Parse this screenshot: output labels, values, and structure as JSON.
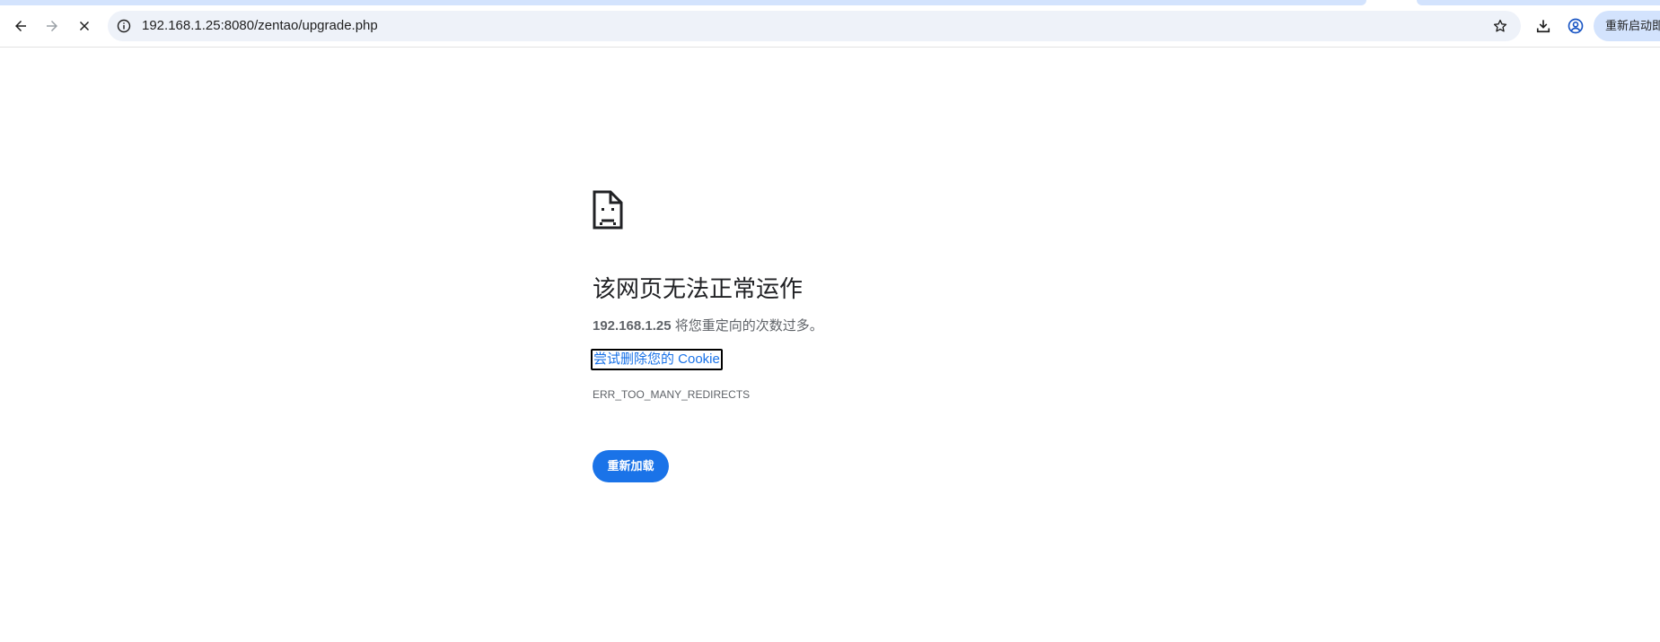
{
  "browser": {
    "address_bar": {
      "url": "192.168.1.25:8080/zentao/upgrade.php"
    },
    "restart_label": "重新启动即",
    "colors": {
      "tab_strip": "#d3e3fd",
      "omnibox_bg": "#eef2f9",
      "accent": "#1a73e8"
    }
  },
  "error_page": {
    "icon": "sad-page-icon",
    "heading": "该网页无法正常运作",
    "host": "192.168.1.25",
    "message": " 将您重定向的次数过多。",
    "cookie_link": "尝试删除您的 Cookie",
    "error_code": "ERR_TOO_MANY_REDIRECTS",
    "reload_label": "重新加载"
  }
}
